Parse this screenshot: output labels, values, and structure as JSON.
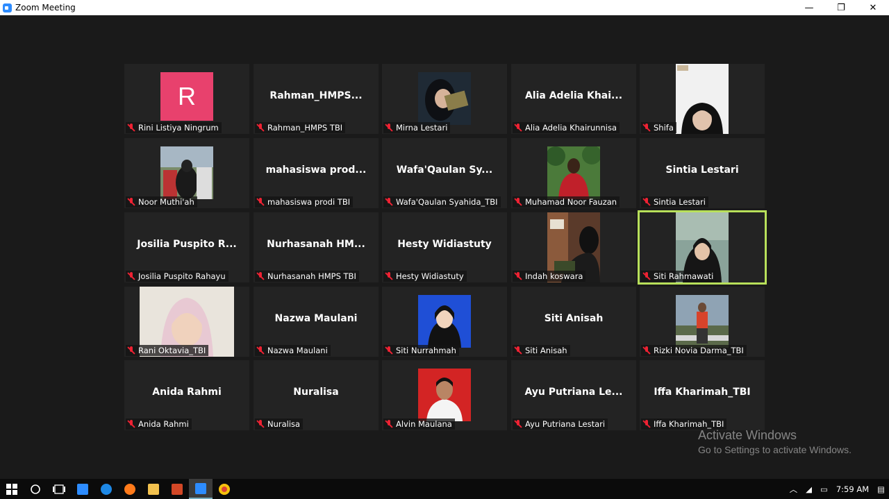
{
  "window": {
    "title": "Zoom Meeting",
    "minimize_icon": "—",
    "restore_icon": "❐",
    "close_icon": "✕"
  },
  "participants": [
    {
      "name": "Rini Listiya Ningrum",
      "avatar_letter": "R"
    },
    {
      "name": "Rahman_HMPS TBI",
      "display_name": "Rahman_HMPS..."
    },
    {
      "name": "Mirna Lestari"
    },
    {
      "name": "Alia Adelia Khairunnisa",
      "display_name": "Alia Adelia Khai..."
    },
    {
      "name": "Shifa"
    },
    {
      "name": "Noor Muthi'ah"
    },
    {
      "name": "mahasiswa prodi TBI",
      "display_name": "mahasiswa prod..."
    },
    {
      "name": "Wafa'Qaulan Syahida_TBI",
      "display_name": "Wafa'Qaulan Sy..."
    },
    {
      "name": "Muhamad Noor Fauzan"
    },
    {
      "name": "Sintia Lestari",
      "display_name": "Sintia Lestari"
    },
    {
      "name": "Josilia Puspito Rahayu",
      "display_name": "Josilia Puspito R..."
    },
    {
      "name": "Nurhasanah HMPS TBI",
      "display_name": "Nurhasanah HM..."
    },
    {
      "name": "Hesty Widiastuty",
      "display_name": "Hesty Widiastuty"
    },
    {
      "name": "Indah koswara"
    },
    {
      "name": "Siti Rahmawati"
    },
    {
      "name": "Rani Oktavia_TBI"
    },
    {
      "name": "Nazwa Maulani",
      "display_name": "Nazwa Maulani"
    },
    {
      "name": "Siti Nurrahmah"
    },
    {
      "name": "Siti Anisah",
      "display_name": "Siti Anisah"
    },
    {
      "name": "Rizki Novia Darma_TBI"
    },
    {
      "name": "Anida Rahmi",
      "display_name": "Anida Rahmi"
    },
    {
      "name": "Nuralisa",
      "display_name": "Nuralisa"
    },
    {
      "name": "Alvin Maulana"
    },
    {
      "name": "Ayu Putriana Lestari",
      "display_name": "Ayu Putriana Le..."
    },
    {
      "name": "Iffa Kharimah_TBI",
      "display_name": "Iffa Kharimah_TBI"
    }
  ],
  "watermark": {
    "title": "Activate Windows",
    "subtitle": "Go to Settings to activate Windows."
  },
  "taskbar": {
    "clock": "7:59 AM",
    "notification_icon": "notification-icon"
  }
}
